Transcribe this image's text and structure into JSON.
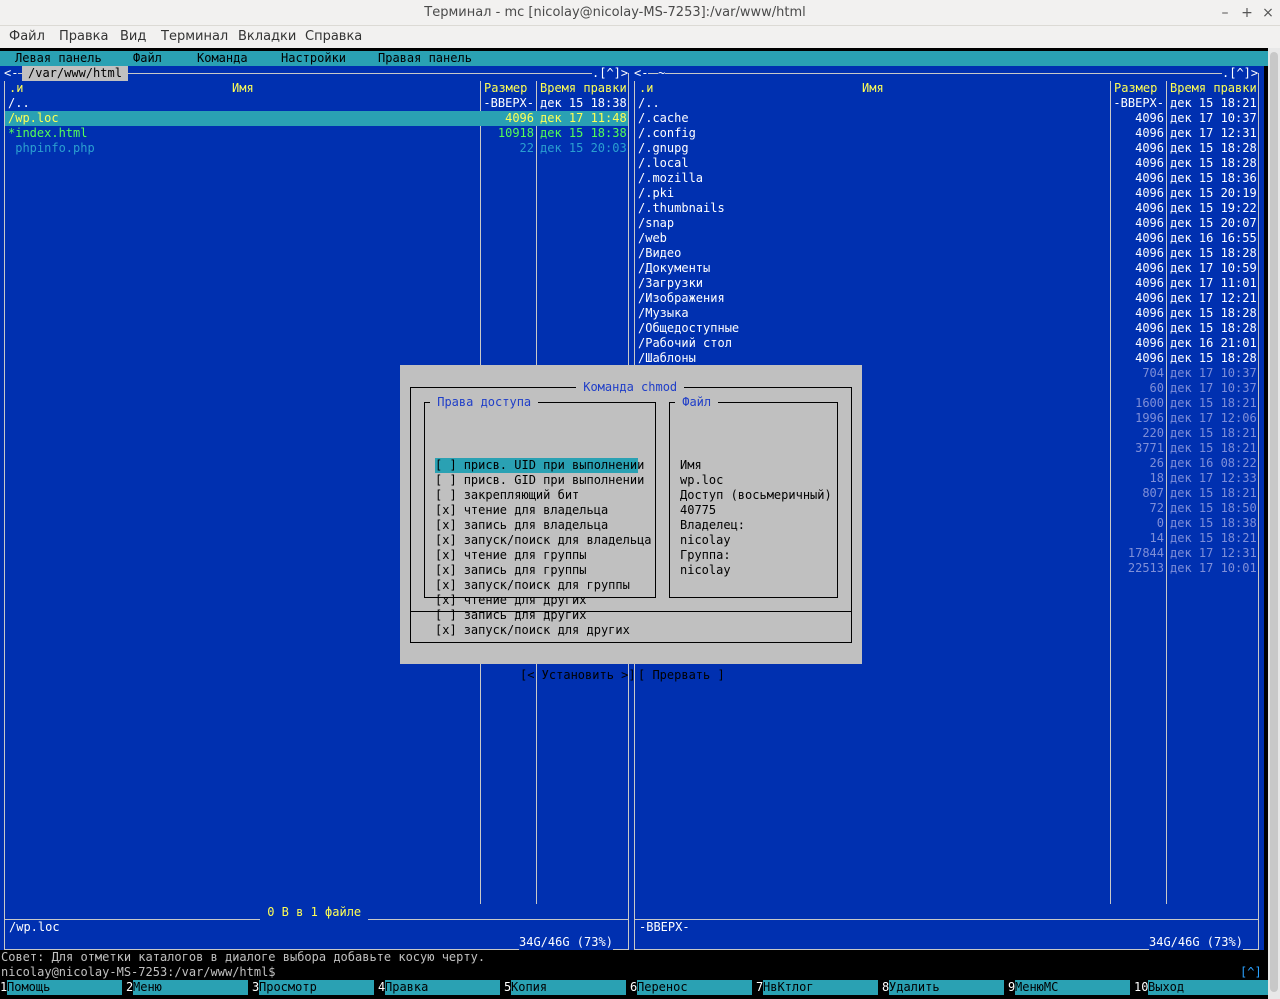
{
  "window": {
    "title": "Терминал - mc [nicolay@nicolay-MS-7253]:/var/www/html",
    "controls": [
      "–",
      "+",
      "×"
    ]
  },
  "app_menu": [
    "Файл",
    "Правка",
    "Вид",
    "Терминал",
    "Вкладки",
    "Справка"
  ],
  "mc_menu": [
    "Левая панель",
    "Файл",
    "Команда",
    "Настройки",
    "Правая панель"
  ],
  "left_panel": {
    "path": "/var/www/html",
    "corner": ".[^]>",
    "nav_arrow": "<-",
    "col_sort": ".и",
    "col_name": "Имя",
    "col_size": "Размер",
    "col_time": "Время правки",
    "rows": [
      {
        "name": "/..",
        "size": "-ВВЕРХ-",
        "time": "дек 15 18:38"
      },
      {
        "name": "/wp.loc",
        "size": "4096",
        "time": "дек 17 11:48"
      },
      {
        "name": "*index.html",
        "size": "10918",
        "time": "дек 15 18:38"
      },
      {
        "name": " phpinfo.php",
        "size": "22",
        "time": "дек 15 20:03"
      }
    ],
    "summary": " 0 В в 1 файле ",
    "status": "/wp.loc",
    "disk": "34G/46G (73%)"
  },
  "right_panel": {
    "path": "~",
    "corner": ".[^]>",
    "nav_arrow": "<-",
    "col_sort": ".и",
    "col_name": "Имя",
    "col_size": "Размер",
    "col_time": "Время правки",
    "rows": [
      {
        "name": "/..",
        "size": "-ВВЕРХ-",
        "time": "дек 15 18:21"
      },
      {
        "name": "/.cache",
        "size": "4096",
        "time": "дек 17 10:37"
      },
      {
        "name": "/.config",
        "size": "4096",
        "time": "дек 17 12:31"
      },
      {
        "name": "/.gnupg",
        "size": "4096",
        "time": "дек 15 18:28"
      },
      {
        "name": "/.local",
        "size": "4096",
        "time": "дек 15 18:28"
      },
      {
        "name": "/.mozilla",
        "size": "4096",
        "time": "дек 15 18:36"
      },
      {
        "name": "/.pki",
        "size": "4096",
        "time": "дек 15 20:19"
      },
      {
        "name": "/.thumbnails",
        "size": "4096",
        "time": "дек 15 19:22"
      },
      {
        "name": "/snap",
        "size": "4096",
        "time": "дек 15 20:07"
      },
      {
        "name": "/web",
        "size": "4096",
        "time": "дек 16 16:55"
      },
      {
        "name": "/Видео",
        "size": "4096",
        "time": "дек 15 18:28"
      },
      {
        "name": "/Документы",
        "size": "4096",
        "time": "дек 17 10:59"
      },
      {
        "name": "/Загрузки",
        "size": "4096",
        "time": "дек 17 11:01"
      },
      {
        "name": "/Изображения",
        "size": "4096",
        "time": "дек 17 12:21"
      },
      {
        "name": "/Музыка",
        "size": "4096",
        "time": "дек 15 18:28"
      },
      {
        "name": "/Общедоступные",
        "size": "4096",
        "time": "дек 15 18:28"
      },
      {
        "name": "/Рабочий стол",
        "size": "4096",
        "time": "дек 16 21:01"
      },
      {
        "name": "/Шаблоны",
        "size": "4096",
        "time": "дек 15 18:28"
      },
      {
        "name": "",
        "size": "704",
        "time": "дек 17 10:37"
      },
      {
        "name": "",
        "size": "60",
        "time": "дек 17 10:37"
      },
      {
        "name": "",
        "size": "1600",
        "time": "дек 15 18:21"
      },
      {
        "name": "",
        "size": "1996",
        "time": "дек 17 12:06"
      },
      {
        "name": "",
        "size": "220",
        "time": "дек 15 18:21"
      },
      {
        "name": "",
        "size": "3771",
        "time": "дек 15 18:21"
      },
      {
        "name": "",
        "size": "26",
        "time": "дек 16 08:22"
      },
      {
        "name": "",
        "size": "18",
        "time": "дек 17 12:33"
      },
      {
        "name": "",
        "size": "807",
        "time": "дек 15 18:21"
      },
      {
        "name": "",
        "size": "72",
        "time": "дек 15 18:50"
      },
      {
        "name": "",
        "size": "0",
        "time": "дек 15 18:38"
      },
      {
        "name": "",
        "size": "14",
        "time": "дек 15 18:21"
      },
      {
        "name": "",
        "size": "17844",
        "time": "дек 17 12:31"
      },
      {
        "name": "",
        "size": "22513",
        "time": "дек 17 10:01"
      }
    ],
    "status": "-ВВЕРХ-",
    "disk": "34G/46G (73%)"
  },
  "chmod_dialog": {
    "title": " Команда chmod ",
    "perm_group_title": " Права доступа ",
    "perms": [
      {
        "check": "[ ]",
        "label": "присв. UID при выполнении"
      },
      {
        "check": "[ ]",
        "label": "присв. GID при выполнении"
      },
      {
        "check": "[ ]",
        "label": "закрепляющий бит"
      },
      {
        "check": "[x]",
        "label": "чтение для владельца"
      },
      {
        "check": "[x]",
        "label": "запись для владельца"
      },
      {
        "check": "[x]",
        "label": "запуск/поиск для владельца"
      },
      {
        "check": "[x]",
        "label": "чтение для группы"
      },
      {
        "check": "[x]",
        "label": "запись для группы"
      },
      {
        "check": "[x]",
        "label": "запуск/поиск для группы"
      },
      {
        "check": "[x]",
        "label": "чтение для других"
      },
      {
        "check": "[ ]",
        "label": "запись для других"
      },
      {
        "check": "[x]",
        "label": "запуск/поиск для других"
      }
    ],
    "file_group_title": " Файл ",
    "file_info": [
      "Имя",
      "wp.loc",
      "Доступ (восьмеричный)",
      "40775",
      "Владелец:",
      "nicolay",
      "Группа:",
      "nicolay"
    ],
    "btn_set": "[< Установить >]",
    "btn_cancel": "[ Прервать ]"
  },
  "hint": "Совет: Для отметки каталогов в диалоге выбора добавьте косую черту.",
  "prompt": "nicolay@nicolay-MS-7253:/var/www/html$",
  "prompt_corner": "[^]",
  "fkeys": [
    {
      "num": "1",
      "label": "Помощь"
    },
    {
      "num": "2",
      "label": "Меню"
    },
    {
      "num": "3",
      "label": "Просмотр"
    },
    {
      "num": "4",
      "label": "Правка"
    },
    {
      "num": "5",
      "label": "Копия"
    },
    {
      "num": "6",
      "label": "Перенос"
    },
    {
      "num": "7",
      "label": "НвКтлог"
    },
    {
      "num": "8",
      "label": "Удалить"
    },
    {
      "num": "9",
      "label": "МенюMC"
    },
    {
      "num": "10",
      "label": "Выход"
    }
  ]
}
